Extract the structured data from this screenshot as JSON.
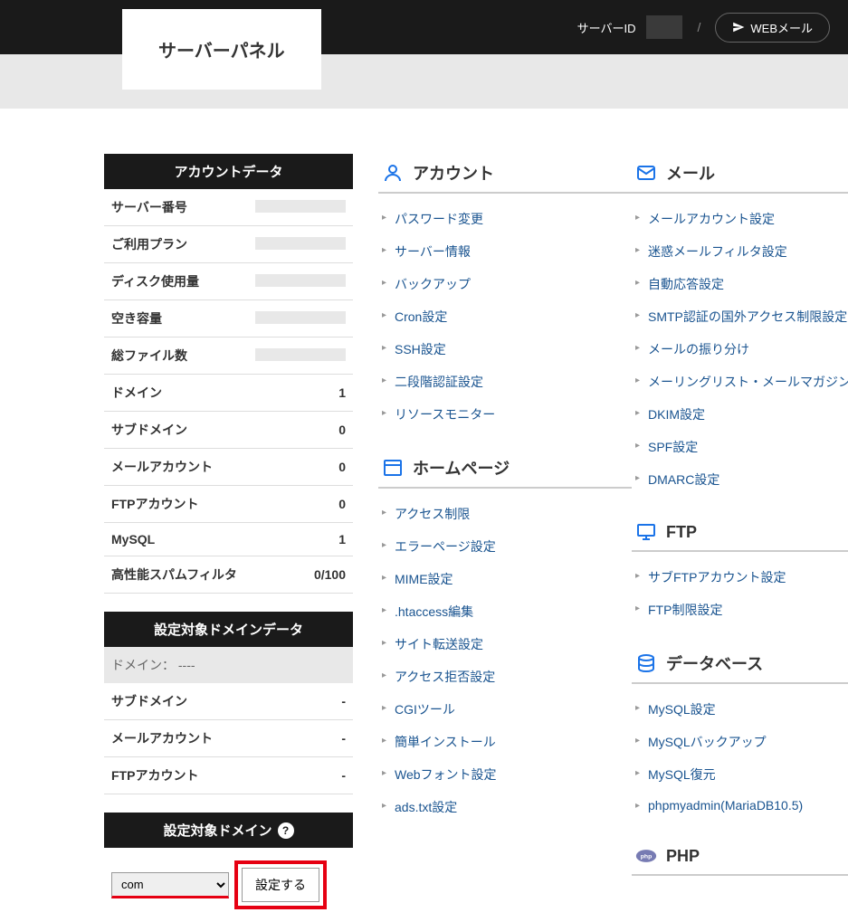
{
  "header": {
    "server_id_label": "サーバーID",
    "server_id_value": "",
    "separator": "/",
    "webmail_label": "WEBメール"
  },
  "logo": "サーバーパネル",
  "account_data": {
    "title": "アカウントデータ",
    "rows": [
      {
        "label": "サーバー番号",
        "value": ""
      },
      {
        "label": "ご利用プラン",
        "value": ""
      },
      {
        "label": "ディスク使用量",
        "value": ""
      },
      {
        "label": "空き容量",
        "value": ""
      },
      {
        "label": "総ファイル数",
        "value": ""
      },
      {
        "label": "ドメイン",
        "value": "1"
      },
      {
        "label": "サブドメイン",
        "value": "0"
      },
      {
        "label": "メールアカウント",
        "value": "0"
      },
      {
        "label": "FTPアカウント",
        "value": "0"
      },
      {
        "label": "MySQL",
        "value": "1"
      },
      {
        "label": "高性能スパムフィルタ",
        "value": "0/100"
      }
    ]
  },
  "target_domain_data": {
    "title": "設定対象ドメインデータ",
    "domain_label": "ドメイン：  ----",
    "rows": [
      {
        "label": "サブドメイン",
        "value": "-"
      },
      {
        "label": "メールアカウント",
        "value": "-"
      },
      {
        "label": "FTPアカウント",
        "value": "-"
      }
    ]
  },
  "target_domain": {
    "title": "設定対象ドメイン",
    "select_value": "com",
    "button": "設定する"
  },
  "sections": {
    "account": {
      "title": "アカウント",
      "links": [
        "パスワード変更",
        "サーバー情報",
        "バックアップ",
        "Cron設定",
        "SSH設定",
        "二段階認証設定",
        "リソースモニター"
      ]
    },
    "homepage": {
      "title": "ホームページ",
      "links": [
        "アクセス制限",
        "エラーページ設定",
        "MIME設定",
        ".htaccess編集",
        "サイト転送設定",
        "アクセス拒否設定",
        "CGIツール",
        "簡単インストール",
        "Webフォント設定",
        "ads.txt設定"
      ]
    },
    "mail": {
      "title": "メール",
      "links": [
        "メールアカウント設定",
        "迷惑メールフィルタ設定",
        "自動応答設定",
        "SMTP認証の国外アクセス制限設定",
        "メールの振り分け",
        "メーリングリスト・メールマガジン",
        "DKIM設定",
        "SPF設定",
        "DMARC設定"
      ]
    },
    "ftp": {
      "title": "FTP",
      "links": [
        "サブFTPアカウント設定",
        "FTP制限設定"
      ]
    },
    "database": {
      "title": "データベース",
      "links": [
        "MySQL設定",
        "MySQLバックアップ",
        "MySQL復元",
        "phpmyadmin(MariaDB10.5)"
      ]
    },
    "php": {
      "title": "PHP",
      "links": []
    }
  }
}
